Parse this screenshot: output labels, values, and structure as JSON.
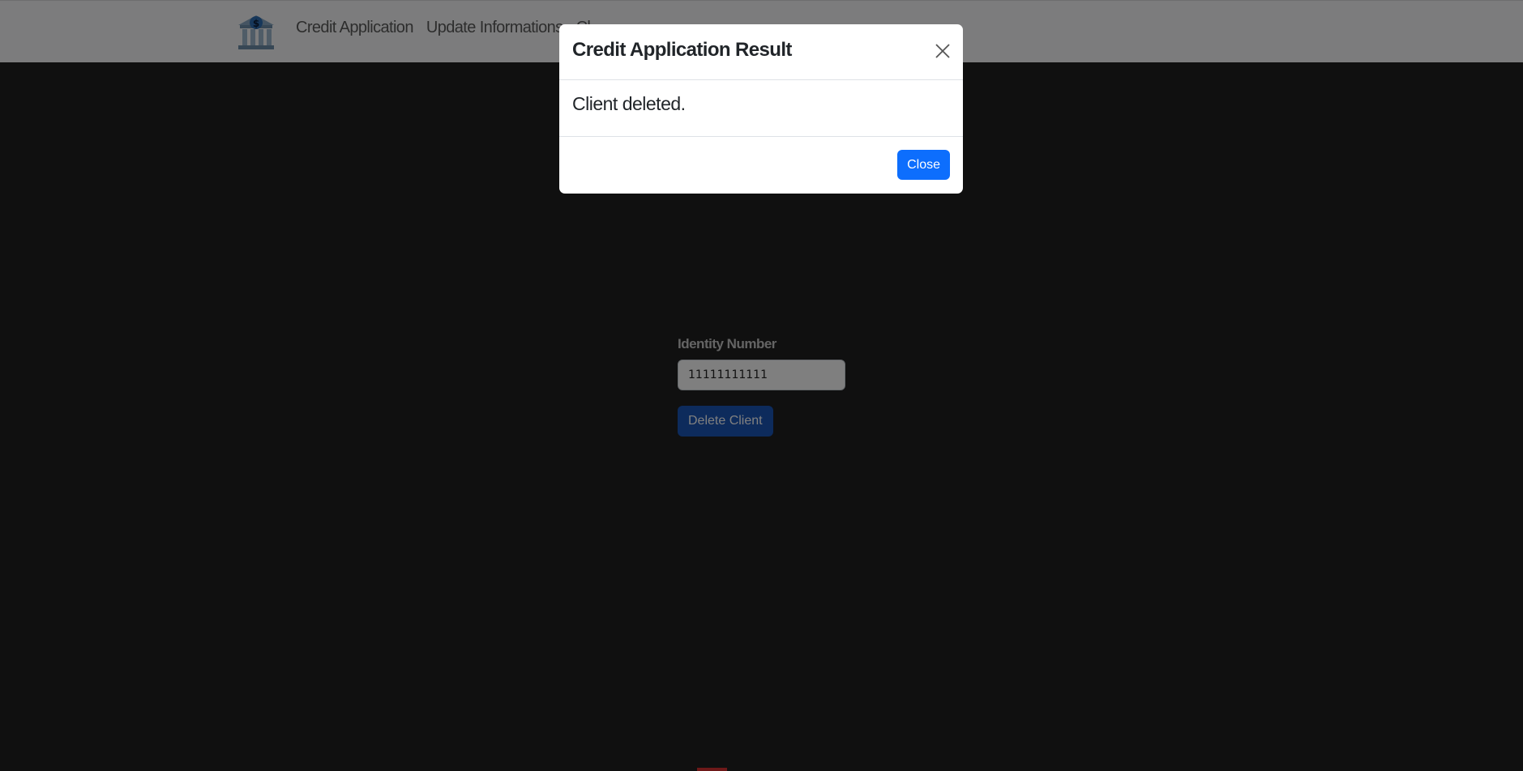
{
  "navbar": {
    "logo_icon": "bank-building-icon",
    "links": [
      {
        "label": "Credit Application"
      },
      {
        "label": "Update Informations"
      },
      {
        "label": "Cl"
      }
    ]
  },
  "form": {
    "identity_label": "Identity Number",
    "identity_value": "11111111111",
    "delete_button": "Delete Client"
  },
  "modal": {
    "title": "Credit Application Result",
    "message": "Client deleted.",
    "close_button": "Close",
    "close_icon": "close-icon"
  },
  "colors": {
    "primary": "#0d6efd",
    "backdrop": "rgba(0,0,0,0.5)"
  }
}
